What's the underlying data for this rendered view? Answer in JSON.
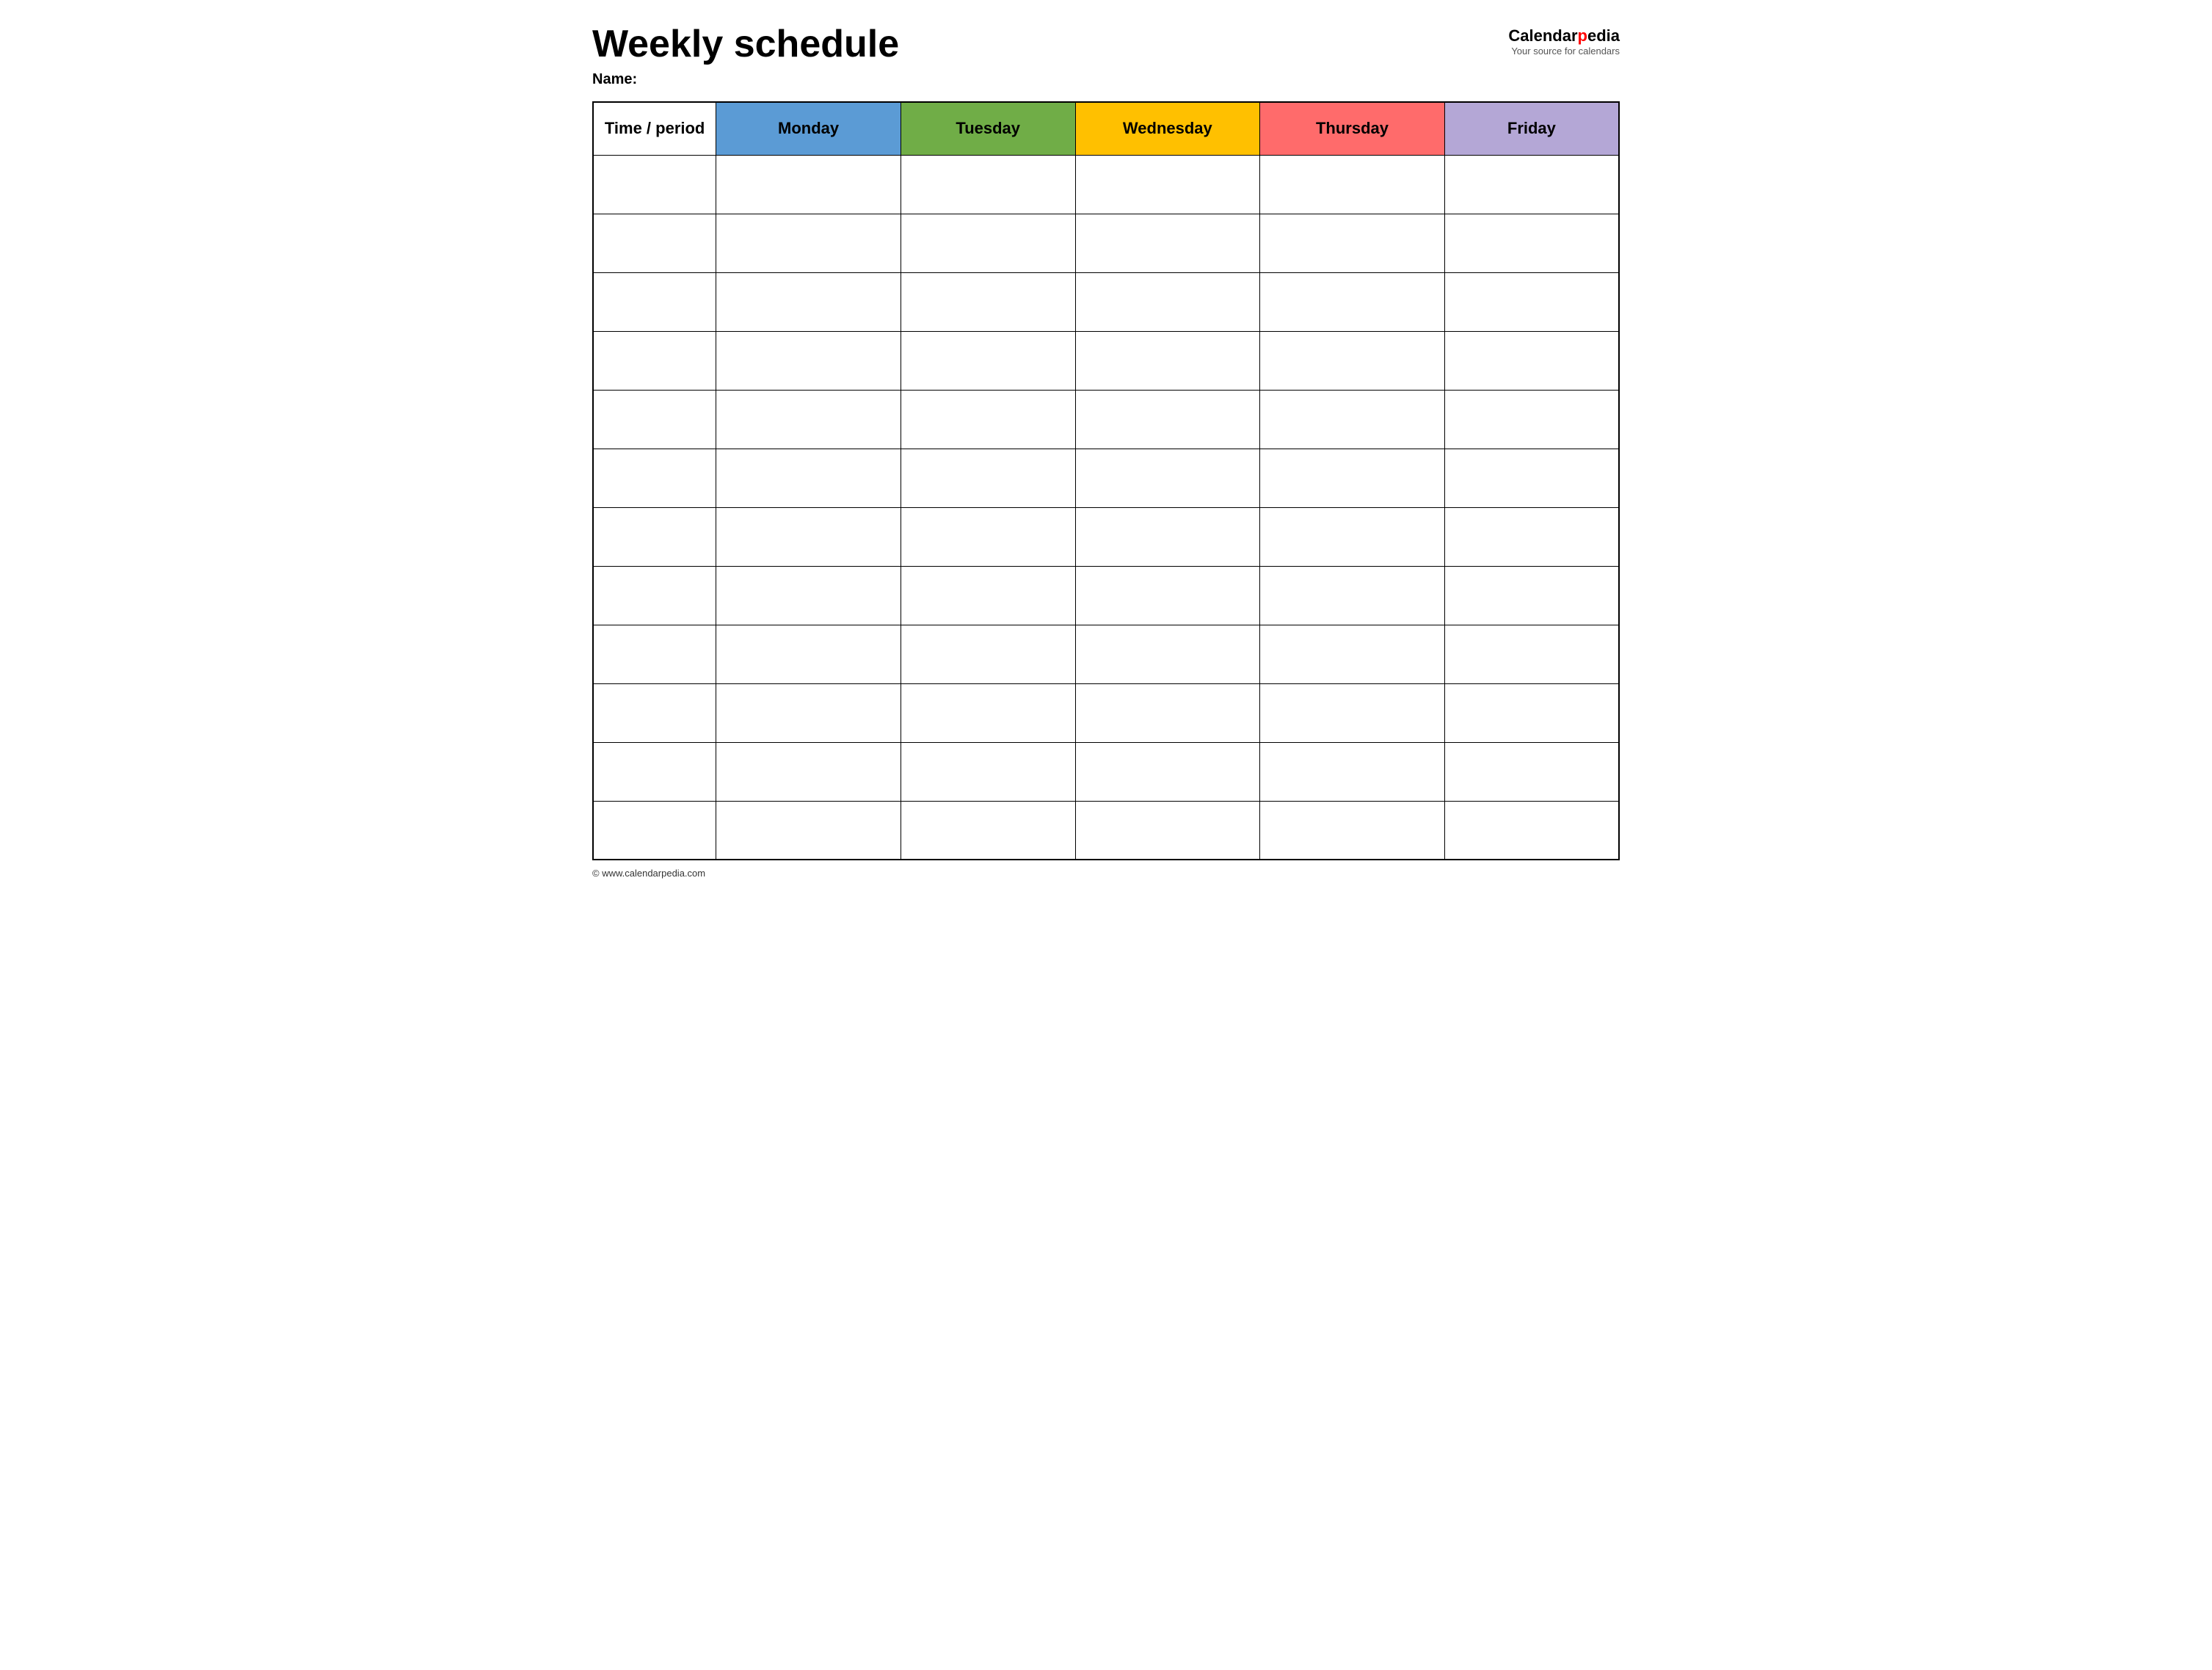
{
  "header": {
    "title": "Weekly schedule",
    "name_label": "Name:",
    "logo": {
      "brand_start": "Calendar",
      "brand_red": "p",
      "brand_end": "edia",
      "tagline": "Your source for calendars"
    }
  },
  "table": {
    "columns": [
      {
        "id": "time",
        "label": "Time / period",
        "color": "#ffffff"
      },
      {
        "id": "monday",
        "label": "Monday",
        "color": "#5b9bd5"
      },
      {
        "id": "tuesday",
        "label": "Tuesday",
        "color": "#70ad47"
      },
      {
        "id": "wednesday",
        "label": "Wednesday",
        "color": "#ffc000"
      },
      {
        "id": "thursday",
        "label": "Thursday",
        "color": "#ff6b6b"
      },
      {
        "id": "friday",
        "label": "Friday",
        "color": "#b4a7d6"
      }
    ],
    "row_count": 12
  },
  "footer": {
    "copyright": "© www.calendarpedia.com"
  }
}
